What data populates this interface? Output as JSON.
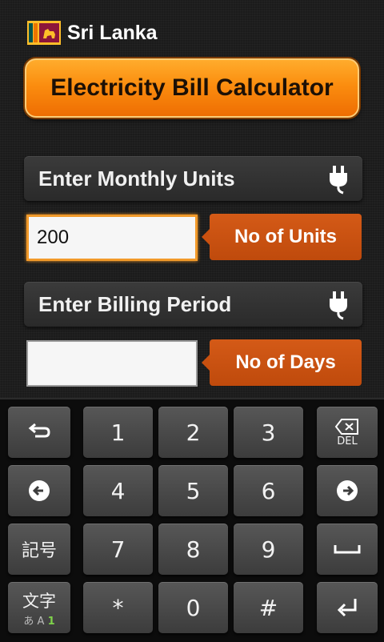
{
  "header": {
    "country": "Sri Lanka",
    "flag_icon": "sri-lanka-flag-icon"
  },
  "title_button": {
    "label": "Electricity Bill Calculator"
  },
  "units_section": {
    "label": "Enter Monthly Units",
    "icon": "plug-icon"
  },
  "units_input": {
    "value": "200",
    "tag": "No of Units"
  },
  "period_section": {
    "label": "Enter Billing Period",
    "icon": "plug-icon"
  },
  "days_input": {
    "value": "",
    "tag": "No of Days"
  },
  "keyboard": {
    "digits": [
      "1",
      "2",
      "3",
      "4",
      "5",
      "6",
      "7",
      "8",
      "9",
      "*",
      "0",
      "#"
    ],
    "del_label": "DEL",
    "symbol_label": "記号",
    "mode_label": "文字",
    "mode_sub_label": "あ A",
    "mode_sub_active": "1"
  },
  "colors": {
    "accent": "#fb8d0f",
    "tag": "#c9500f",
    "active_mode": "#7fd34a"
  }
}
